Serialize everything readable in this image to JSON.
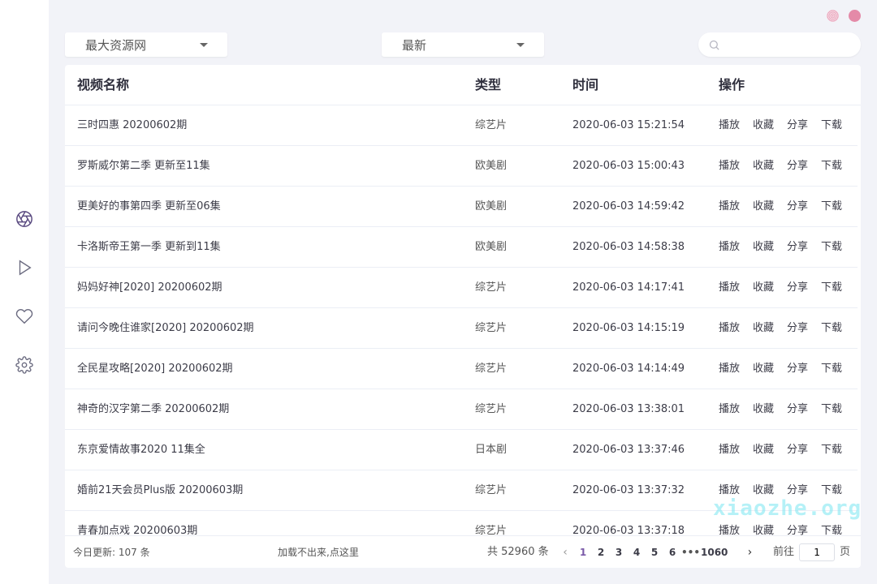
{
  "colors": {
    "accent": "#7a5aa8",
    "close": "#e48aa8",
    "minimize": "#f2b6c9"
  },
  "sidebar": {
    "items": [
      {
        "icon": "aperture-icon",
        "active": true
      },
      {
        "icon": "play-icon",
        "active": false
      },
      {
        "icon": "heart-icon",
        "active": false
      },
      {
        "icon": "gear-icon",
        "active": false
      }
    ]
  },
  "filters": {
    "source": "最大资源网",
    "sort": "最新"
  },
  "search": {
    "placeholder": ""
  },
  "table": {
    "headers": {
      "name": "视频名称",
      "type": "类型",
      "time": "时间",
      "ops": "操作"
    },
    "ops": [
      "播放",
      "收藏",
      "分享",
      "下载"
    ],
    "rows": [
      {
        "name": "三时四惠 20200602期",
        "type": "综艺片",
        "time": "2020-06-03 15:21:54"
      },
      {
        "name": "罗斯威尔第二季 更新至11集",
        "type": "欧美剧",
        "time": "2020-06-03 15:00:43"
      },
      {
        "name": "更美好的事第四季 更新至06集",
        "type": "欧美剧",
        "time": "2020-06-03 14:59:42"
      },
      {
        "name": "卡洛斯帝王第一季 更新到11集",
        "type": "欧美剧",
        "time": "2020-06-03 14:58:38"
      },
      {
        "name": "妈妈好神[2020] 20200602期",
        "type": "综艺片",
        "time": "2020-06-03 14:17:41"
      },
      {
        "name": "请问今晚住谁家[2020] 20200602期",
        "type": "综艺片",
        "time": "2020-06-03 14:15:19"
      },
      {
        "name": "全民星攻略[2020] 20200602期",
        "type": "综艺片",
        "time": "2020-06-03 14:14:49"
      },
      {
        "name": "神奇的汉字第二季 20200602期",
        "type": "综艺片",
        "time": "2020-06-03 13:38:01"
      },
      {
        "name": "东京爱情故事2020 11集全",
        "type": "日本剧",
        "time": "2020-06-03 13:37:46"
      },
      {
        "name": "婚前21天会员Plus版 20200603期",
        "type": "综艺片",
        "time": "2020-06-03 13:37:32"
      },
      {
        "name": "青春加点戏 20200603期",
        "type": "综艺片",
        "time": "2020-06-03 13:37:18"
      }
    ]
  },
  "footer": {
    "today": "今日更新: 107 条",
    "retry": "加载不出来,点这里",
    "total": "共 52960 条",
    "pages": [
      "1",
      "2",
      "3",
      "4",
      "5",
      "6"
    ],
    "dots": "•••",
    "last_page": "1060",
    "goto_label": "前往",
    "goto_value": "1",
    "goto_suffix": "页"
  },
  "watermark": "xiaozhe.org"
}
